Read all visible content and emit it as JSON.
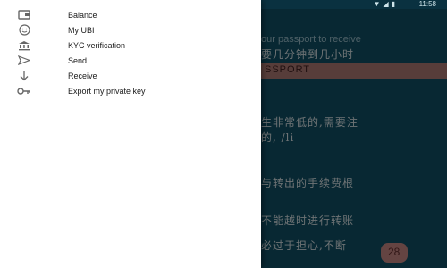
{
  "status_bar": {
    "time": "11:58",
    "icons": [
      "wifi-icon",
      "signal-icon",
      "battery-icon"
    ]
  },
  "background": {
    "title_text": "our passport to receive",
    "passport_button": "SSPORT",
    "fab_label": "28",
    "garbled_lines": [
      "要几分钟到几小时",
      "生非常低的,需要注",
      "的, /li",
      "与转出的手续费根",
      "不能越时进行转账",
      "必过于担心,不断"
    ]
  },
  "drawer": {
    "items": [
      {
        "label": "Balance",
        "icon": "wallet-icon"
      },
      {
        "label": "My UBI",
        "icon": "face-icon"
      },
      {
        "label": "KYC verification",
        "icon": "bank-icon"
      },
      {
        "label": "Send",
        "icon": "send-icon"
      },
      {
        "label": "Receive",
        "icon": "receive-arrow-icon"
      },
      {
        "label": "Export my private key",
        "icon": "key-icon"
      }
    ]
  }
}
